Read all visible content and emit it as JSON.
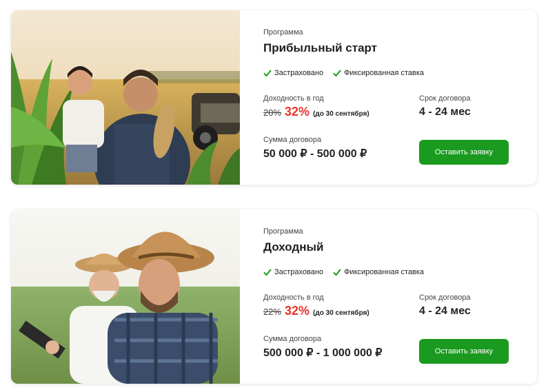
{
  "check_color": "#1a9a1f",
  "accent_red": "#e8342b",
  "cards": [
    {
      "kicker": "Программа",
      "title": "Прибыльный старт",
      "features": [
        "Застраховано",
        "Фиксированная ставка"
      ],
      "yield_label": "Доходность в год",
      "yield_old": "20%",
      "yield_new": "32%",
      "yield_note": "(до 30 сентября)",
      "term_label": "Срок договора",
      "term_value": "4 - 24 мес",
      "sum_label": "Сумма договора",
      "sum_value": "50 000 ₽  - 500 000 ₽",
      "button_label": "Оставить заявку",
      "photo_icon": "farmer-with-child-photo"
    },
    {
      "kicker": "Программа",
      "title": "Доходный",
      "features": [
        "Застраховано",
        "Фиксированная ставка"
      ],
      "yield_label": "Доходность в год",
      "yield_old": "22%",
      "yield_new": "32%",
      "yield_note": "(до 30 сентября)",
      "term_label": "Срок договора",
      "term_value": "4 - 24 мес",
      "sum_label": "Сумма договора",
      "sum_value": "500 000 ₽  - 1 000 000 ₽",
      "button_label": "Оставить заявку",
      "photo_icon": "two-farmers-in-field-photo"
    }
  ]
}
